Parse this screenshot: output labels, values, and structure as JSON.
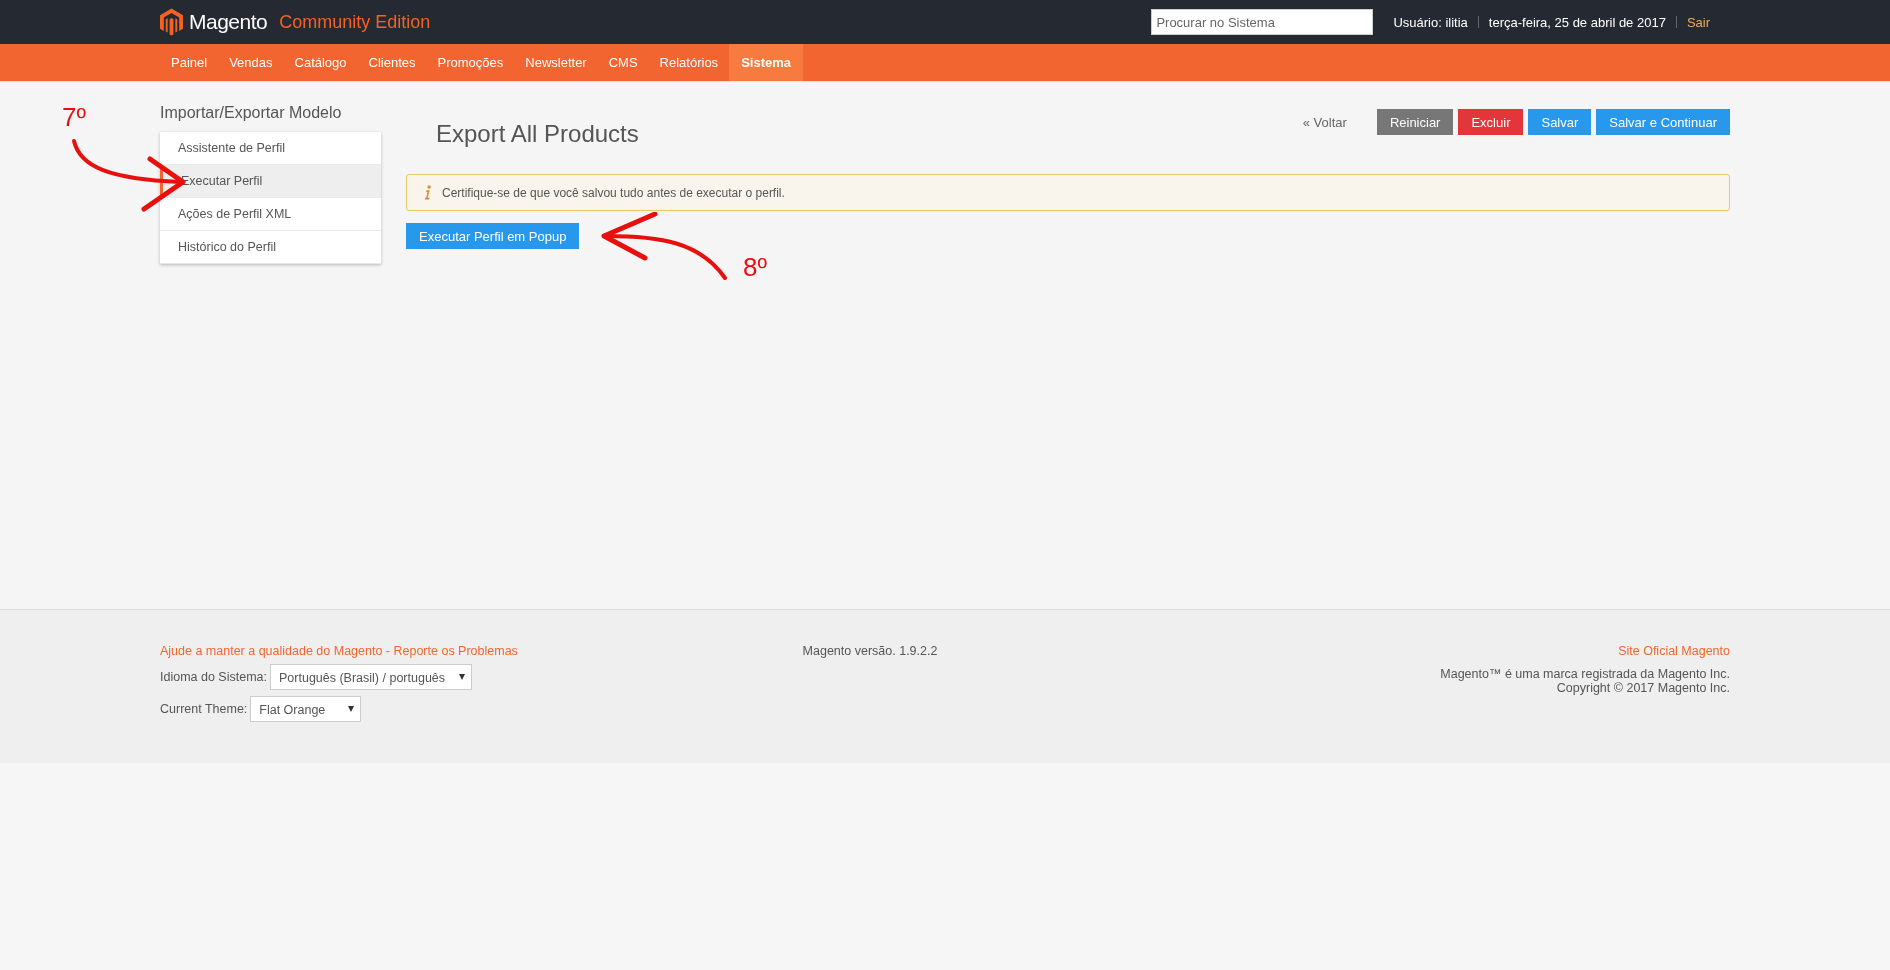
{
  "header": {
    "logo": "Magento",
    "edition": "Community Edition",
    "search": {
      "placeholder": "Procurar no Sistema"
    },
    "user": "Usuário: ilitia",
    "date": "terça-feira, 25 de abril de 2017",
    "logout": "Sair"
  },
  "nav": [
    {
      "label": "Painel",
      "selected": false
    },
    {
      "label": "Vendas",
      "selected": false
    },
    {
      "label": "Catálogo",
      "selected": false
    },
    {
      "label": "Clientes",
      "selected": false
    },
    {
      "label": "Promoções",
      "selected": false
    },
    {
      "label": "Newsletter",
      "selected": false
    },
    {
      "label": "CMS",
      "selected": false
    },
    {
      "label": "Relatórios",
      "selected": false
    },
    {
      "label": "Sistema",
      "selected": true
    }
  ],
  "sidebar": {
    "title": "Importar/Exportar Modelo",
    "items": [
      {
        "label": "Assistente de Perfil",
        "selected": false
      },
      {
        "label": "Executar Perfil",
        "selected": true
      },
      {
        "label": "Ações de Perfil XML",
        "selected": false
      },
      {
        "label": "Histórico do Perfil",
        "selected": false
      }
    ]
  },
  "main": {
    "title": "Export All Products",
    "buttons": [
      {
        "label": "« Voltar",
        "kind": "back"
      },
      {
        "label": "Reiniciar",
        "kind": "reset"
      },
      {
        "label": "Excluir",
        "kind": "delete"
      },
      {
        "label": "Salvar",
        "kind": "save"
      },
      {
        "label": "Salvar e Continuar",
        "kind": "save"
      }
    ],
    "notice": "Certifique-se de que você salvou tudo antes de executar o perfil.",
    "run_button": "Executar Perfil em Popup"
  },
  "annotations": [
    "7º",
    "8º"
  ],
  "footer": {
    "report_link": "Ajude a manter a qualidade do Magento - Reporte os Problemas",
    "language_label": "Idioma do Sistema:",
    "language_value": "Português (Brasil) / português",
    "theme_label": "Current Theme:",
    "theme_value": "Flat Orange",
    "version": "Magento versão. 1.9.2.2",
    "official_link": "Site Oficial Magento",
    "trademark": "Magento™ é uma marca registrada da Magento Inc.",
    "copyright": "Copyright © 2017 Magento Inc."
  }
}
